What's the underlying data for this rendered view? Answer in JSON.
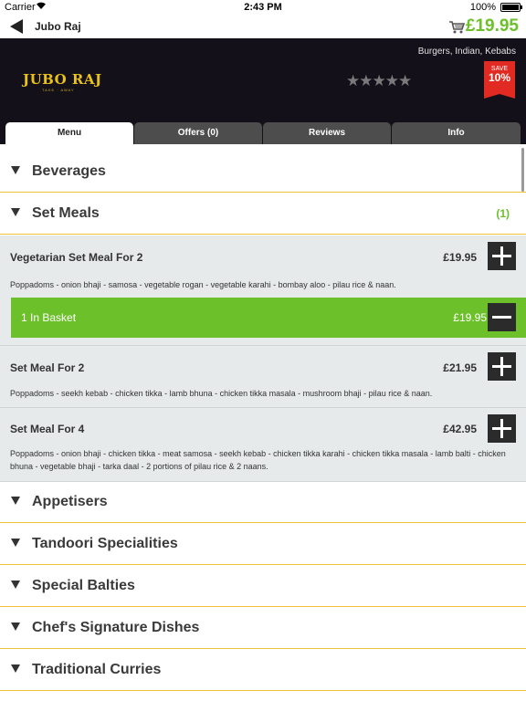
{
  "status_bar": {
    "carrier": "Carrier",
    "time": "2:43 PM",
    "battery": "100%"
  },
  "nav": {
    "title": "Jubo Raj",
    "cart_total": "£19.95"
  },
  "hero": {
    "cuisines": "Burgers, Indian, Kebabs",
    "logo_text": "JUBO RAJ",
    "logo_subtext": "TAKE · AWAY",
    "rating_stars": "★★★★★",
    "rating_value": 0,
    "badge_save": "SAVE",
    "badge_percent": "10%",
    "badge_color": "#e02a22"
  },
  "tabs": [
    {
      "label": "Menu",
      "active": true
    },
    {
      "label": "Offers (0)",
      "active": false
    },
    {
      "label": "Reviews",
      "active": false
    },
    {
      "label": "Info",
      "active": false
    }
  ],
  "categories": {
    "beverages": "Beverages",
    "set_meals": "Set Meals",
    "set_meals_count": "(1)",
    "appetisers": "Appetisers",
    "tandoori": "Tandoori Specialities",
    "balties": "Special Balties",
    "chefs": "Chef's Signature Dishes",
    "curries": "Traditional Curries"
  },
  "items": [
    {
      "name": "Vegetarian Set Meal For 2",
      "price": "£19.95",
      "description": "Poppadoms - onion bhaji - samosa - vegetable rogan - vegetable karahi - bombay aloo - pilau rice & naan."
    },
    {
      "name": "Set Meal For 2",
      "price": "£21.95",
      "description": "Poppadoms - seekh kebab - chicken tikka - lamb bhuna - chicken tikka masala - mushroom bhaji - pilau rice & naan."
    },
    {
      "name": "Set Meal For 4",
      "price": "£42.95",
      "description": "Poppadoms - onion bhaji - chicken tikka - meat samosa - seekh kebab - chicken tikka karahi - chicken tikka masala - lamb balti - chicken bhuna - vegetable bhaji - tarka daal - 2 portions of pilau rice & 2 naans."
    }
  ],
  "basket": {
    "label": "1 In Basket",
    "price": "£19.95"
  },
  "colors": {
    "accent_green": "#6cc12a",
    "divider_gold": "#f0c23a",
    "hero_bg": "#14101a",
    "tab_inactive": "#4d4d4d"
  },
  "icons": {
    "back": "back-arrow-icon",
    "cart": "cart-icon",
    "expand": "triangle-down-icon",
    "add": "plus-icon",
    "remove": "minus-icon"
  }
}
